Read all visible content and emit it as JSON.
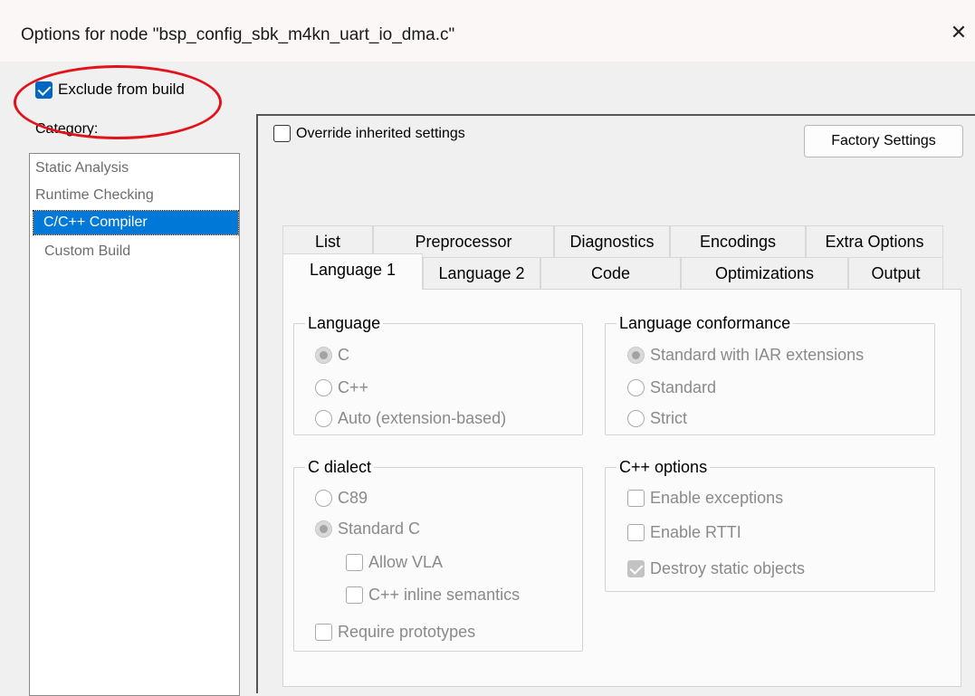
{
  "window": {
    "title": "Options for node \"bsp_config_sbk_m4kn_uart_io_dma.c\"",
    "close_glyph": "✕"
  },
  "exclude_from_build": {
    "label": "Exclude from build",
    "checked": true
  },
  "category": {
    "label": "Category:",
    "items": [
      {
        "label": "Static Analysis"
      },
      {
        "label": "Runtime Checking"
      },
      {
        "label": "C/C++ Compiler",
        "selected": true
      },
      {
        "label": "Custom Build"
      }
    ]
  },
  "override": {
    "label": "Override inherited settings",
    "checked": false
  },
  "factory_settings_label": "Factory Settings",
  "tabs": {
    "back_row": [
      "List",
      "Preprocessor",
      "Diagnostics",
      "Encodings",
      "Extra Options"
    ],
    "front_row": [
      "Language 1",
      "Language 2",
      "Code",
      "Optimizations",
      "Output"
    ],
    "active": "Language 1"
  },
  "groups": {
    "language": {
      "title": "Language",
      "options": [
        {
          "label": "C",
          "checked": true
        },
        {
          "label": "C++",
          "checked": false
        },
        {
          "label": "Auto (extension-based)",
          "checked": false
        }
      ]
    },
    "conformance": {
      "title": "Language conformance",
      "options": [
        {
          "label": "Standard with IAR extensions",
          "checked": true
        },
        {
          "label": "Standard",
          "checked": false
        },
        {
          "label": "Strict",
          "checked": false
        }
      ]
    },
    "c_dialect": {
      "title": "C dialect",
      "options": [
        {
          "label": "C89",
          "checked": false
        },
        {
          "label": "Standard C",
          "checked": true
        }
      ],
      "sub_options": [
        {
          "label": "Allow VLA",
          "checked": false
        },
        {
          "label": "C++ inline semantics",
          "checked": false
        }
      ],
      "require_prototypes": {
        "label": "Require prototypes",
        "checked": false
      }
    },
    "cpp_options": {
      "title": "C++ options",
      "options": [
        {
          "label": "Enable exceptions",
          "checked": false
        },
        {
          "label": "Enable RTTI",
          "checked": false
        },
        {
          "label": "Destroy static objects",
          "checked": true
        }
      ]
    }
  },
  "colors": {
    "accent": "#0067c0",
    "selection": "#0078d7",
    "annotation": "#e0141a",
    "disabled_text": "#8a8a8a"
  }
}
